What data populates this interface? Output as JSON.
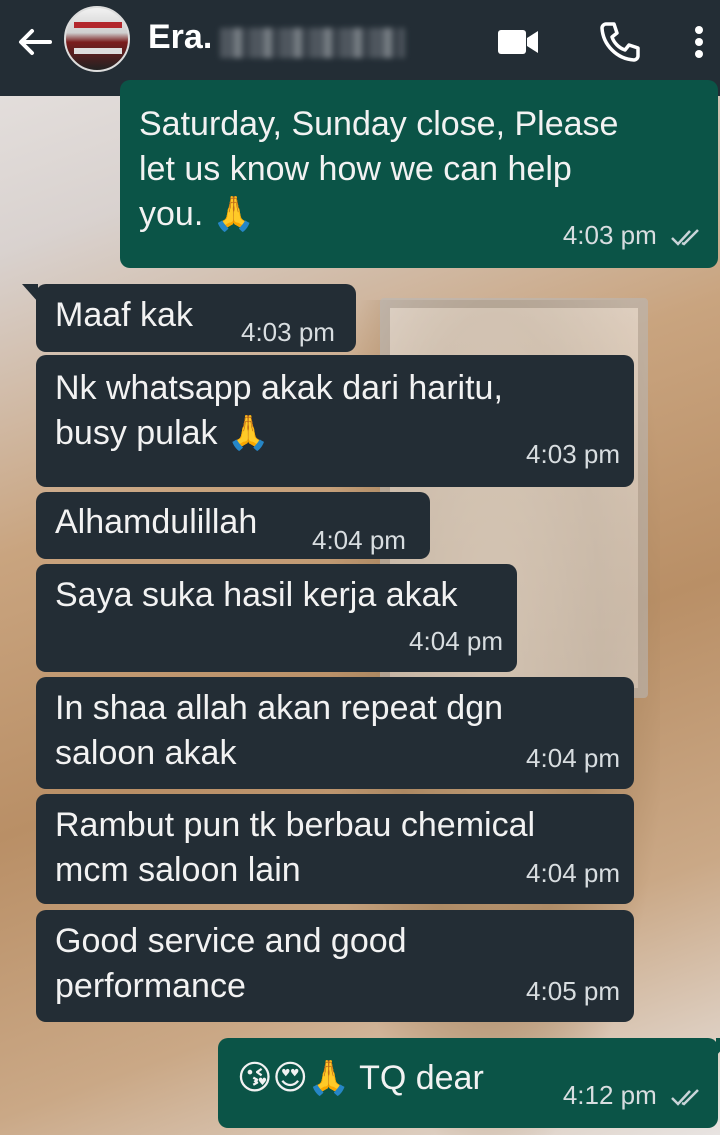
{
  "header": {
    "contact_name": "Era.",
    "icons": [
      "back-arrow-icon",
      "avatar",
      "video-call-icon",
      "phone-call-icon",
      "more-vert-icon"
    ]
  },
  "colors": {
    "header_bg": "#232d35",
    "incoming_bubble": "#232d35",
    "outgoing_bubble": "#0b5447",
    "read_tick": "#9ad7f0"
  },
  "messages": [
    {
      "dir": "out",
      "lines": [
        "Saturday, Sunday close, Please",
        "let us know how we can help",
        "you."
      ],
      "emoji": "🙏",
      "time": "4:03 pm",
      "read": true
    },
    {
      "dir": "in",
      "lines": [
        "Maaf kak"
      ],
      "time": "4:03 pm"
    },
    {
      "dir": "in",
      "lines": [
        "Nk whatsapp akak dari haritu,",
        "busy pulak"
      ],
      "emoji": "🙏",
      "time": "4:03 pm"
    },
    {
      "dir": "in",
      "lines": [
        "Alhamdulillah"
      ],
      "time": "4:04 pm"
    },
    {
      "dir": "in",
      "lines": [
        "Saya suka hasil kerja akak"
      ],
      "time": "4:04 pm"
    },
    {
      "dir": "in",
      "lines": [
        "In shaa allah akan repeat dgn",
        "saloon akak"
      ],
      "time": "4:04 pm"
    },
    {
      "dir": "in",
      "lines": [
        "Rambut pun tk berbau chemical",
        "mcm saloon lain"
      ],
      "time": "4:04 pm"
    },
    {
      "dir": "in",
      "lines": [
        "Good service and good",
        "performance"
      ],
      "time": "4:05 pm"
    },
    {
      "dir": "out",
      "lines": [
        "TQ dear"
      ],
      "emoji_prefix": "😘😍🙏",
      "time": "4:12 pm",
      "read": true
    }
  ]
}
